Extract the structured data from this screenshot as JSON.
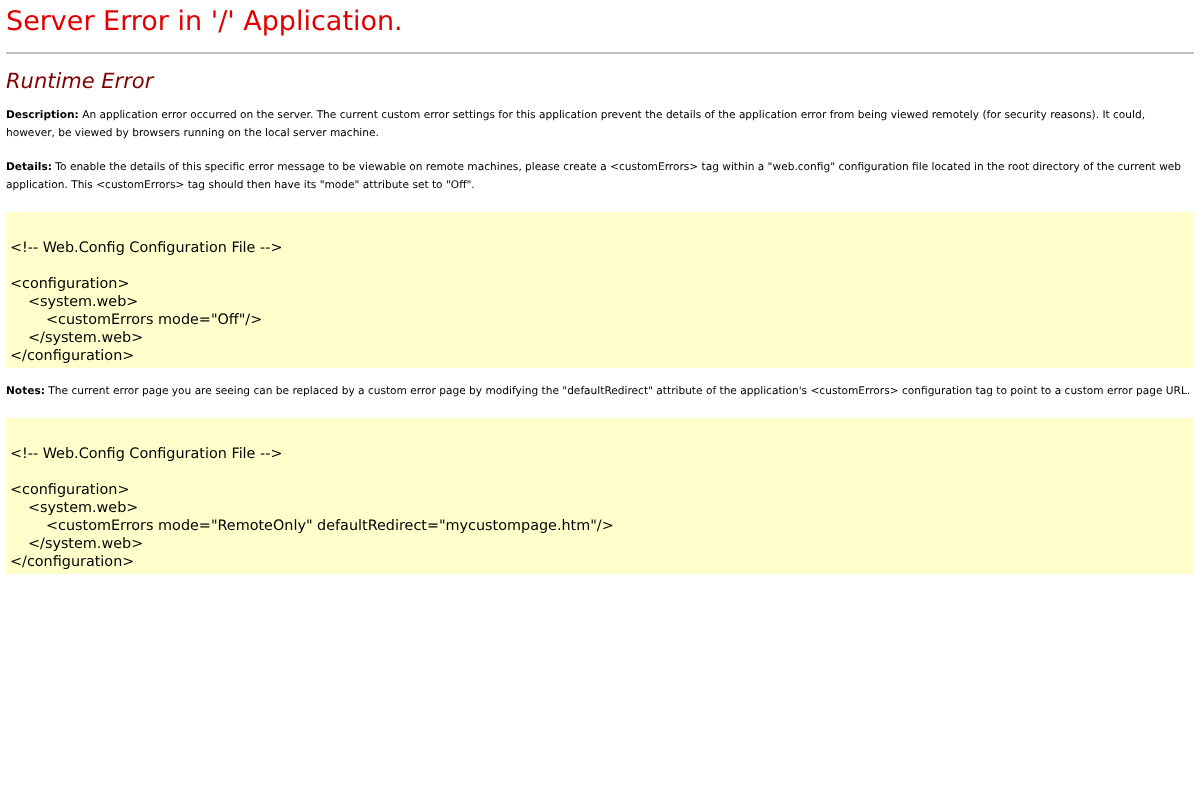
{
  "title": "Server Error in '/' Application.",
  "heading": "Runtime Error",
  "sections": [
    {
      "kind": "text",
      "text": "**Description:** An application error occurred on the server. The current custom error settings for this application prevent the details of the application error from being viewed remotely (for security reasons). It could, however, be viewed by browsers running on the local server machine."
    },
    {
      "kind": "text",
      "text": "**Details:** To enable the details of this specific error message to be viewable on remote machines, please create a <customErrors> tag within a \"web.config\" configuration file located in the root directory of the current web application. This <customErrors> tag should then have its \"mode\" attribute set to \"Off\"."
    },
    {
      "kind": "code",
      "lines": [
        {
          "text": "<!-- Web.Config Configuration File -->"
        },
        {
          "text": "<configuration>",
          "children": [
            {
              "text": "<system.web>",
              "children": [
                {
                  "text": "<customErrors mode=\"Off\"/>"
                }
              ]
            },
            {
              "text": "</system.web>"
            }
          ]
        },
        {
          "text": "</configuration>"
        }
      ]
    },
    {
      "kind": "text",
      "text": "**Notes:** The current error page you are seeing can be replaced by a custom error page by modifying the \"defaultRedirect\" attribute of the application's <customErrors> configuration tag to point to a custom error page URL."
    },
    {
      "kind": "code",
      "lines": [
        {
          "text": "<!-- Web.Config Configuration File -->"
        },
        {
          "text": "<configuration>",
          "children": [
            {
              "text": "<system.web>",
              "children": [
                {
                  "text": "<customErrors mode=\"RemoteOnly\" defaultRedirect=\"mycustompage.htm\"/>"
                }
              ]
            },
            {
              "text": "</system.web>"
            }
          ]
        },
        {
          "text": "</configuration>"
        }
      ]
    }
  ]
}
